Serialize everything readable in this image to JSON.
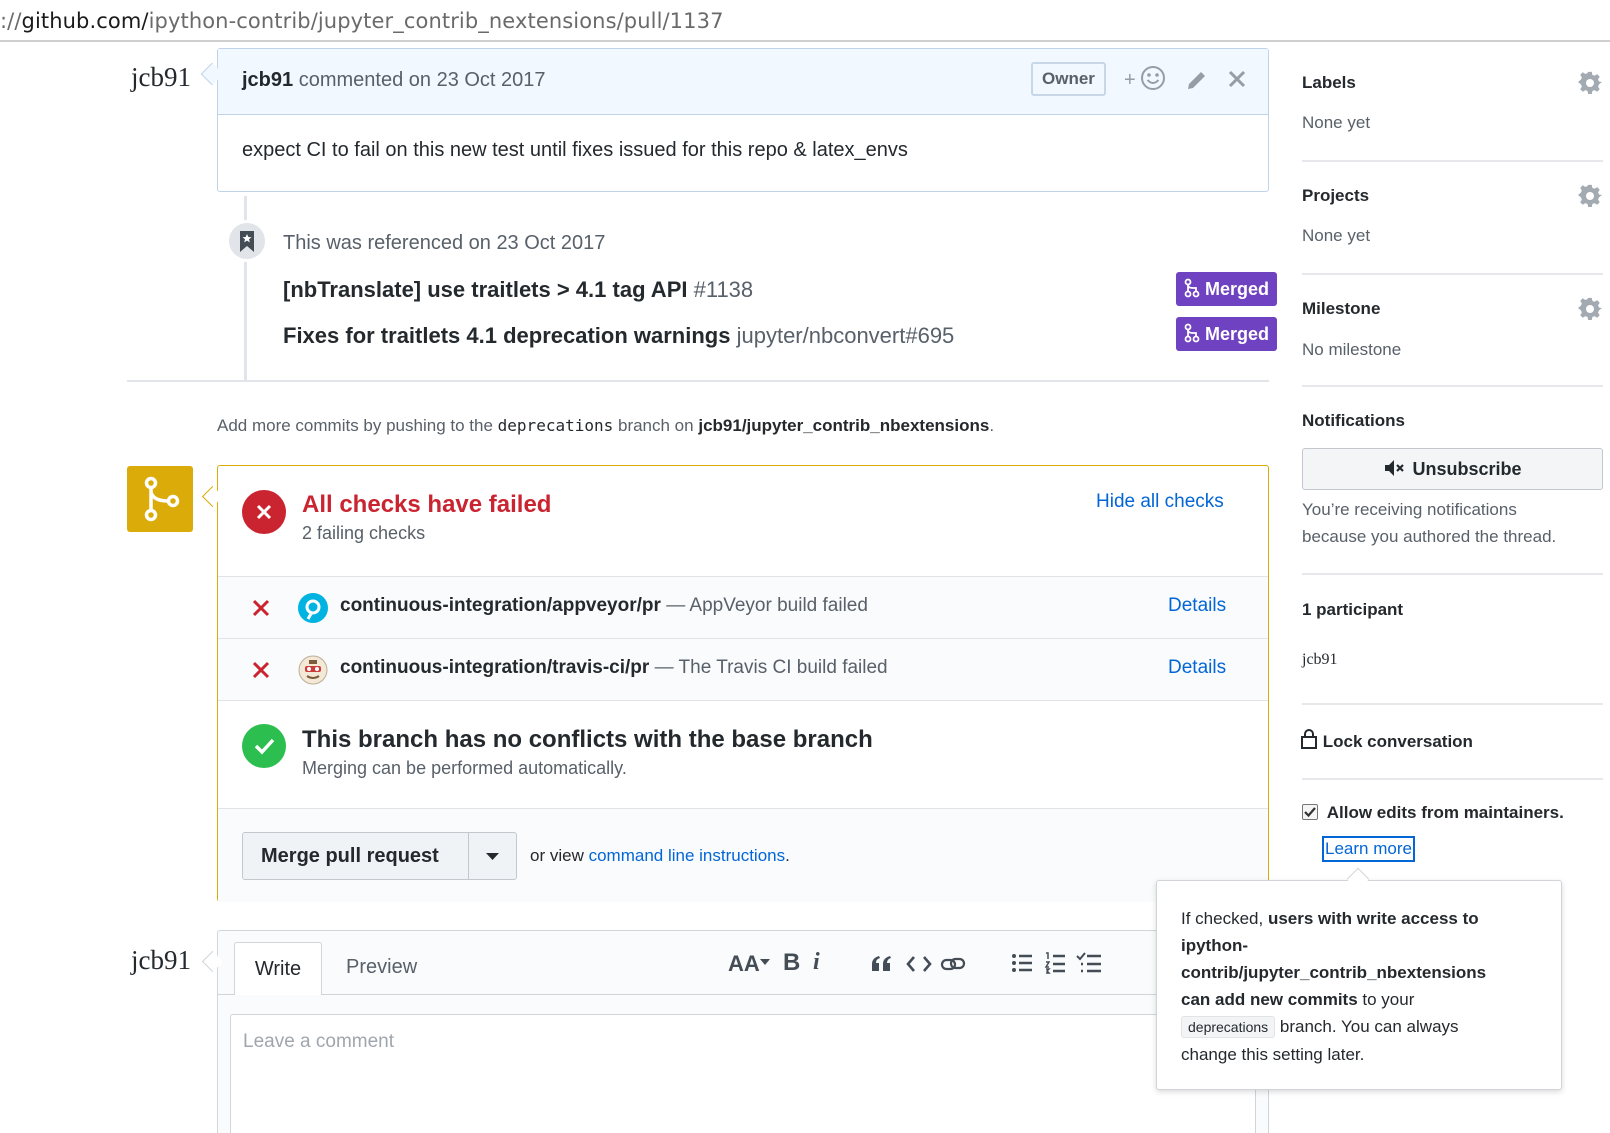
{
  "browser": {
    "url_prefix": "://",
    "url_domain": "github.com/",
    "url_path": "ipython-contrib/jupyter_contrib_nextensions/pull/1137"
  },
  "comment": {
    "avatar": "jcb91",
    "author": "jcb91",
    "meta": "commented on 23 Oct 2017",
    "badge": "Owner",
    "add_reaction": "+",
    "body": "expect CI to fail on this new test until fixes issued for this repo & latex_envs"
  },
  "reference": {
    "text": "This was referenced on 23 Oct 2017",
    "items": [
      {
        "title": "[nbTranslate] use traitlets > 4.1 tag API",
        "ref": "#1138",
        "status": "Merged"
      },
      {
        "title": "Fixes for traitlets 4.1 deprecation warnings",
        "ref": "jupyter/nbconvert#695",
        "status": "Merged"
      }
    ]
  },
  "branch_hint": {
    "prefix": "Add more commits by pushing to the",
    "branch": "deprecations",
    "middle": "branch on",
    "repo": "jcb91/jupyter_contrib_nbextensions",
    "suffix": "."
  },
  "checks": {
    "title": "All checks have failed",
    "subtitle": "2 failing checks",
    "toggle": "Hide all checks",
    "rows": [
      {
        "name": "continuous-integration/appveyor/pr",
        "desc": "— AppVeyor build failed",
        "link": "Details"
      },
      {
        "name": "continuous-integration/travis-ci/pr",
        "desc": "— The Travis CI build failed",
        "link": "Details"
      }
    ]
  },
  "conflicts": {
    "title": "This branch has no conflicts with the base branch",
    "subtitle": "Merging can be performed automatically."
  },
  "merge": {
    "button": "Merge pull request",
    "or_view": "or view",
    "cli_link": "command line instructions",
    "cli_suffix": "."
  },
  "editor": {
    "avatar": "jcb91",
    "tab_write": "Write",
    "tab_preview": "Preview",
    "toolbar_text_size": "AA",
    "toolbar_bold": "B",
    "toolbar_italic": "i",
    "placeholder": "Leave a comment"
  },
  "sidebar": {
    "labels": {
      "title": "Labels",
      "value": "None yet"
    },
    "projects": {
      "title": "Projects",
      "value": "None yet"
    },
    "milestone": {
      "title": "Milestone",
      "value": "No milestone"
    },
    "notifications": {
      "title": "Notifications",
      "button": "Unsubscribe",
      "line1": "You’re receiving notifications",
      "line2": "because you authored the thread."
    },
    "participants": {
      "title": "1 participant",
      "name": "jcb91"
    },
    "lock": "Lock conversation",
    "allow_edits": "Allow edits from maintainers.",
    "learn_more": "Learn more"
  },
  "tooltip": {
    "p1": "If checked, ",
    "b1": "users with write access to",
    "b2": "ipython-",
    "b3": "contrib/jupyter_contrib_nbextensions",
    "b4": "can add new commits",
    "p2": " to your",
    "code": "deprecations",
    "p3": " branch. You can always",
    "p4": "change this setting later."
  },
  "colors": {
    "accent_link": "#0366d6",
    "merged": "#6f42c1",
    "fail": "#cb2431",
    "success": "#2cbe4e",
    "pending": "#dbab09"
  }
}
